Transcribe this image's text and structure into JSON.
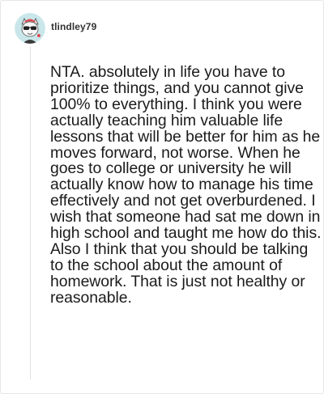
{
  "comment": {
    "username": "tlindley79",
    "avatar_icon": "cat-sunglasses-avatar-icon",
    "text": "NTA. absolutely in life you have to prioritize things, and you cannot give 100% to everything. I think you were actually teaching him valuable life lessons that will be better for him as he moves forward, not worse. When he goes to college or university he will actually know how to manage his time effectively and not get overburdened. I wish that someone had sat me down in high school and taught me how do this. Also I think that you should be talking to the school about the amount of homework. That is just not healthy or reasonable."
  },
  "colors": {
    "avatar_bg": "#c9e7ea",
    "avatar_hair": "#e0484f",
    "text": "#1b1b1b",
    "border": "#e6e6e6"
  }
}
